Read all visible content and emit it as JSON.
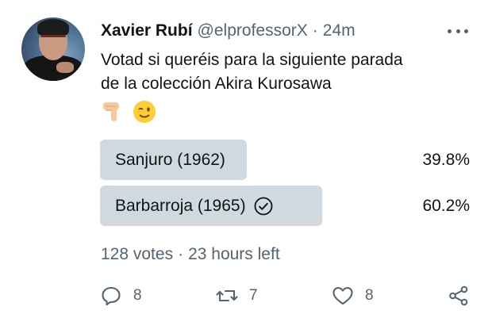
{
  "author": {
    "name": "Xavier Rubí",
    "handle": "@elprofessorX",
    "separator": "·",
    "time": "24m"
  },
  "tweet": {
    "text_line1": "Votad si queréis para la siguiente parada",
    "text_line2": "de la colección Akira Kurosawa",
    "emojis": [
      "backhand-index-pointing-down",
      "winking-face"
    ]
  },
  "poll": {
    "options": [
      {
        "label": "Sanjuro (1962)",
        "percent": "39.8%",
        "fraction": 0.398,
        "selected": false
      },
      {
        "label": "Barbarroja (1965)",
        "percent": "60.2%",
        "fraction": 0.602,
        "selected": true
      }
    ],
    "votes": "128 votes",
    "separator": "·",
    "time_left": "23 hours left"
  },
  "actions": {
    "reply_count": "8",
    "retweet_count": "7",
    "like_count": "8",
    "icons": [
      "reply-icon",
      "retweet-icon",
      "like-icon",
      "share-icon"
    ]
  },
  "colors": {
    "text": "#0f1419",
    "secondary": "#536471",
    "poll_bar": "#cfd9de"
  }
}
